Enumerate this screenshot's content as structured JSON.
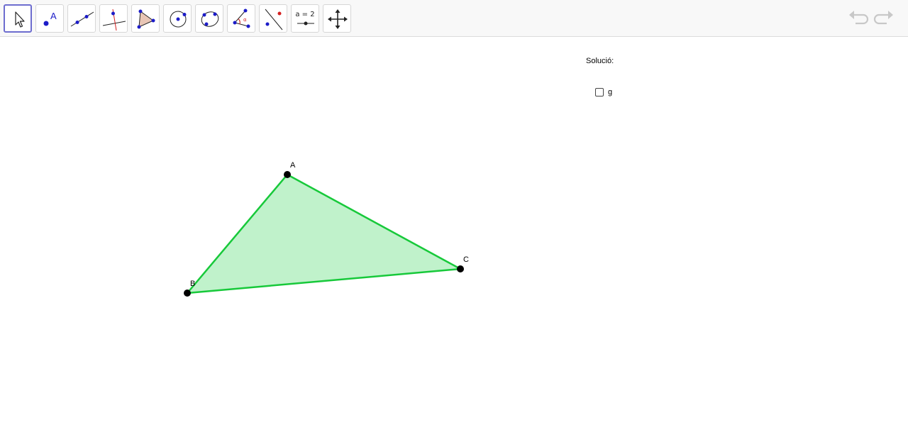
{
  "toolbar": {
    "tools": [
      {
        "name": "move-tool",
        "active": true
      },
      {
        "name": "point-tool"
      },
      {
        "name": "line-tool"
      },
      {
        "name": "perpendicular-line-tool"
      },
      {
        "name": "polygon-tool"
      },
      {
        "name": "circle-tool"
      },
      {
        "name": "conic-tool"
      },
      {
        "name": "angle-tool"
      },
      {
        "name": "reflect-tool"
      },
      {
        "name": "slider-tool",
        "label": "a = 2"
      },
      {
        "name": "move-graphics-view-tool"
      }
    ],
    "undo_icon": "undo-icon",
    "redo_icon": "redo-icon"
  },
  "panel": {
    "solution_label": "Solució:",
    "checkbox": {
      "label": "g",
      "checked": false
    }
  },
  "construction": {
    "points": [
      {
        "label": "A"
      },
      {
        "label": "B"
      },
      {
        "label": "C"
      }
    ],
    "polygon": {
      "vertices": [
        "A",
        "B",
        "C"
      ]
    },
    "colors": {
      "edge": "#17c93a",
      "fill": "#c0f2cb",
      "point": "#000000",
      "accent": "#6d6dcf",
      "icon_blue": "#1c1cc8",
      "icon_red": "#d42020"
    }
  }
}
